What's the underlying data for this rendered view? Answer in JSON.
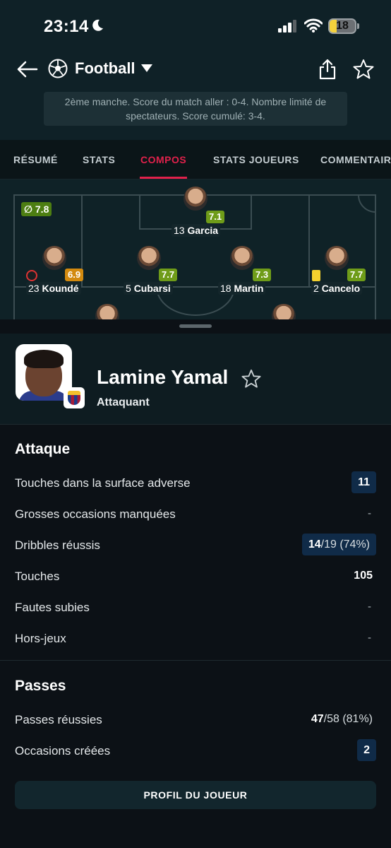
{
  "status_bar": {
    "time": "23:14",
    "battery": "18"
  },
  "nav": {
    "sport": "Football"
  },
  "banner": {
    "line1": "2ème manche. Score du match aller : 0-4. Nombre limité de",
    "line2": "spectateurs. Score cumulé: 3-4."
  },
  "tabs": [
    "RÉSUMÉ",
    "STATS",
    "COMPOS",
    "STATS JOUEURS",
    "COMMENTAIR"
  ],
  "active_tab": "COMPOS",
  "pitch": {
    "team_rating": "7.8",
    "players": [
      {
        "number": "13",
        "name": "Garcia",
        "rating": "7.1",
        "rating_color": "green"
      },
      {
        "number": "23",
        "name": "Koundé",
        "rating": "6.9",
        "rating_color": "orange"
      },
      {
        "number": "5",
        "name": "Cubarsi",
        "rating": "7.7",
        "rating_color": "green"
      },
      {
        "number": "18",
        "name": "Martin",
        "rating": "7.3",
        "rating_color": "green"
      },
      {
        "number": "2",
        "name": "Cancelo",
        "rating": "7.7",
        "rating_color": "green"
      }
    ]
  },
  "player": {
    "name": "Lamine Yamal",
    "position": "Attaquant"
  },
  "sections": [
    {
      "title": "Attaque",
      "rows": [
        {
          "label": "Touches dans la surface adverse",
          "value": "11"
        },
        {
          "label": "Grosses occasions manquées",
          "value": "-"
        },
        {
          "label": "Dribbles réussis",
          "value_bold": "14",
          "value_rest": "/19 (74%)"
        },
        {
          "label": "Touches",
          "value": "105"
        },
        {
          "label": "Fautes subies",
          "value": "-"
        },
        {
          "label": "Hors-jeux",
          "value": "-"
        }
      ]
    },
    {
      "title": "Passes",
      "rows": [
        {
          "label": "Passes réussies",
          "value_bold": "47",
          "value_rest": "/58 (81%)"
        },
        {
          "label": "Occasions créées",
          "value": "2"
        }
      ]
    }
  ],
  "profile_button": "PROFIL DU JOUEUR",
  "colors": {
    "accent": "#e0214b",
    "rating_green": "#6f9c19",
    "rating_orange": "#d38a0f",
    "highlight_pill": "#102b48"
  }
}
